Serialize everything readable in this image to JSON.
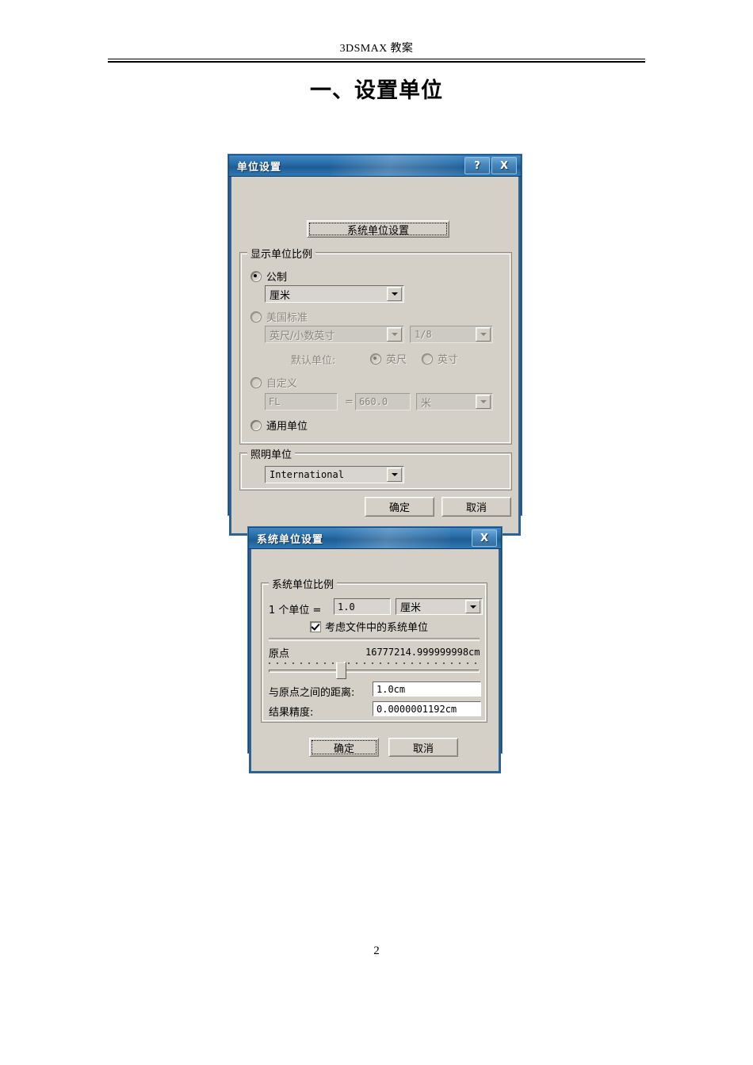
{
  "document": {
    "header_text": "3DSMAX 教案",
    "title": "一、设置单位",
    "page_number": "2"
  },
  "units_dialog": {
    "title": "单位设置",
    "help_button": "?",
    "close_button": "X",
    "system_unit_setup_button": "系统单位设置",
    "display_scale_group": "显示单位比例",
    "metric": {
      "label": "公制",
      "selected": true,
      "value": "厘米"
    },
    "us_standard": {
      "label": "美国标准",
      "selected": false,
      "format_value": "英尺/小数英寸",
      "fraction_value": "1/8",
      "default_units_label": "默认单位:",
      "feet_label": "英尺",
      "feet_selected": true,
      "inches_label": "英寸",
      "inches_selected": false
    },
    "custom": {
      "label": "自定义",
      "selected": false,
      "name_value": "FL",
      "equals": "=",
      "amount_value": "660.0",
      "unit_value": "米"
    },
    "generic": {
      "label": "通用单位",
      "selected": false
    },
    "lighting_group": "照明单位",
    "lighting_value": "International",
    "ok_button": "确定",
    "cancel_button": "取消"
  },
  "system_units_dialog": {
    "title": "系统单位设置",
    "close_button": "X",
    "scale_group": "系统单位比例",
    "one_unit_label": "1 个单位 =",
    "scale_value": "1.0",
    "scale_unit": "厘米",
    "respect_file_units_label": "考虑文件中的系统单位",
    "respect_file_units_checked": true,
    "origin_label": "原点",
    "origin_value": "16777214.999999998cm",
    "slider_position_percent": 33,
    "distance_label": "与原点之间的距离:",
    "distance_value": "1.0cm",
    "accuracy_label": "结果精度:",
    "accuracy_value": "0.0000001192cm",
    "ok_button": "确定",
    "cancel_button": "取消"
  },
  "colors": {
    "title_bar_blue": "#2a6ea8",
    "dialog_face": "#d4d0c8",
    "border_blue": "#2d6292",
    "disabled_text": "#8a867e"
  }
}
